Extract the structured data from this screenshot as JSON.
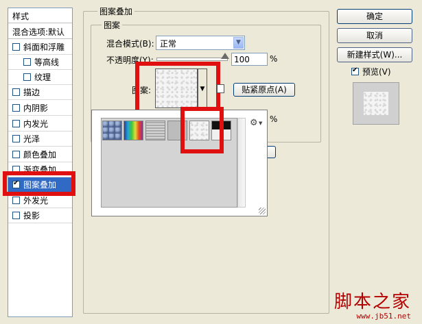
{
  "left_panel": {
    "header": "样式",
    "blend_options": "混合选项:默认",
    "items": [
      {
        "label": "斜面和浮雕",
        "checked": false,
        "sub": false
      },
      {
        "label": "等高线",
        "checked": false,
        "sub": true
      },
      {
        "label": "纹理",
        "checked": false,
        "sub": true
      },
      {
        "label": "描边",
        "checked": false,
        "sub": false
      },
      {
        "label": "内阴影",
        "checked": false,
        "sub": false
      },
      {
        "label": "内发光",
        "checked": false,
        "sub": false
      },
      {
        "label": "光泽",
        "checked": false,
        "sub": false
      },
      {
        "label": "颜色叠加",
        "checked": false,
        "sub": false
      },
      {
        "label": "渐变叠加",
        "checked": false,
        "sub": false
      },
      {
        "label": "图案叠加",
        "checked": true,
        "sub": false,
        "selected": true
      },
      {
        "label": "外发光",
        "checked": false,
        "sub": false
      },
      {
        "label": "投影",
        "checked": false,
        "sub": false
      }
    ]
  },
  "main": {
    "group_title": "图案叠加",
    "sub_group_title": "图案",
    "blend_mode_label": "混合模式(B):",
    "blend_mode_value": "正常",
    "opacity_label": "不透明度(Y):",
    "opacity_value": "100",
    "opacity_unit": "%",
    "pattern_label": "图案:",
    "snap_button": "贴紧原点(A)",
    "scale_unit": "%"
  },
  "buttons": {
    "ok": "确定",
    "cancel": "取消",
    "new_style": "新建样式(W)...",
    "preview_label": "预览(V)",
    "preview_checked": true
  },
  "watermark": {
    "title": "脚本之家",
    "url": "www.jb51.net"
  }
}
